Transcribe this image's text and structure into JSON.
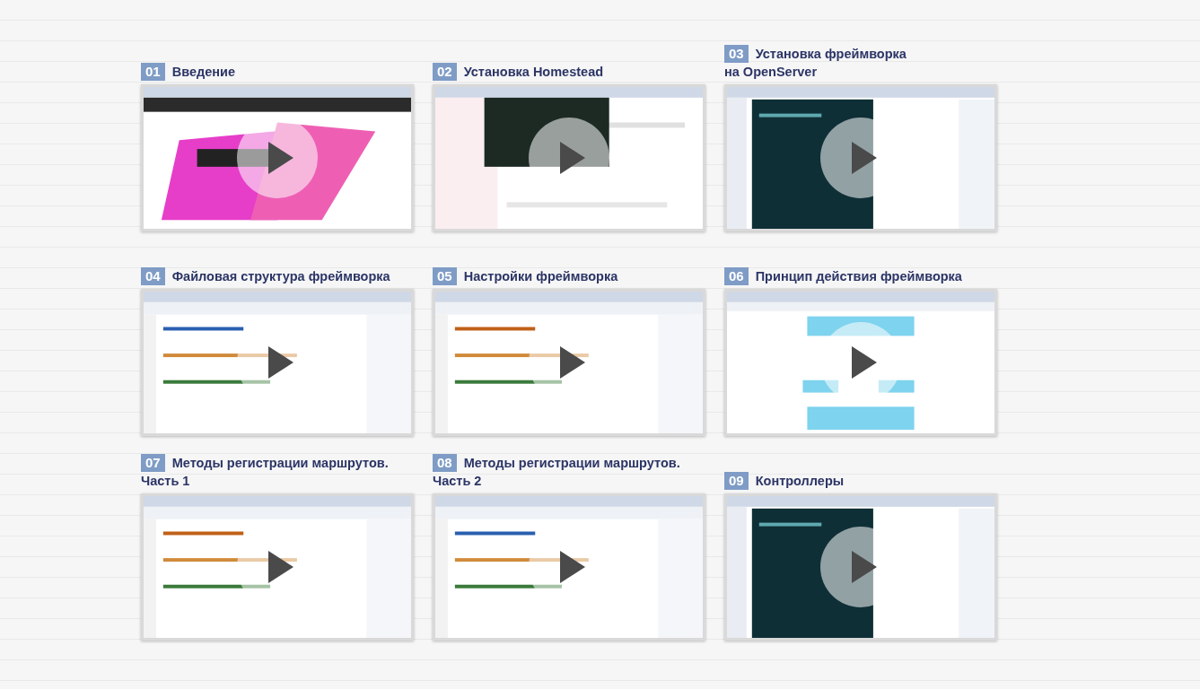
{
  "lessons": [
    {
      "number": "01",
      "title_lines": [
        "Введение"
      ],
      "video": {
        "kind": "picture"
      }
    },
    {
      "number": "02",
      "title_lines": [
        "Установка Homestead"
      ],
      "video": {
        "kind": "picture"
      }
    },
    {
      "number": "03",
      "title_lines": [
        "Установка фреймворка",
        "на OpenServer"
      ],
      "video": {
        "kind": "picture"
      }
    },
    {
      "number": "04",
      "title_lines": [
        "Файловая структура фреймворка"
      ],
      "video": {
        "kind": "picture"
      }
    },
    {
      "number": "05",
      "title_lines": [
        "Настройки фреймворка"
      ],
      "video": {
        "kind": "picture"
      }
    },
    {
      "number": "06",
      "title_lines": [
        "Принцип действия фреймворка"
      ],
      "video": {
        "kind": "picture"
      }
    },
    {
      "number": "07",
      "title_lines": [
        "Методы регистрации маршрутов.",
        "Часть 1"
      ],
      "video": {
        "kind": "picture"
      }
    },
    {
      "number": "08",
      "title_lines": [
        "Методы регистрации маршрутов.",
        "Часть 2"
      ],
      "video": {
        "kind": "picture"
      }
    },
    {
      "number": "09",
      "title_lines": [
        "Контроллеры"
      ],
      "video": {
        "kind": "picture"
      }
    }
  ]
}
